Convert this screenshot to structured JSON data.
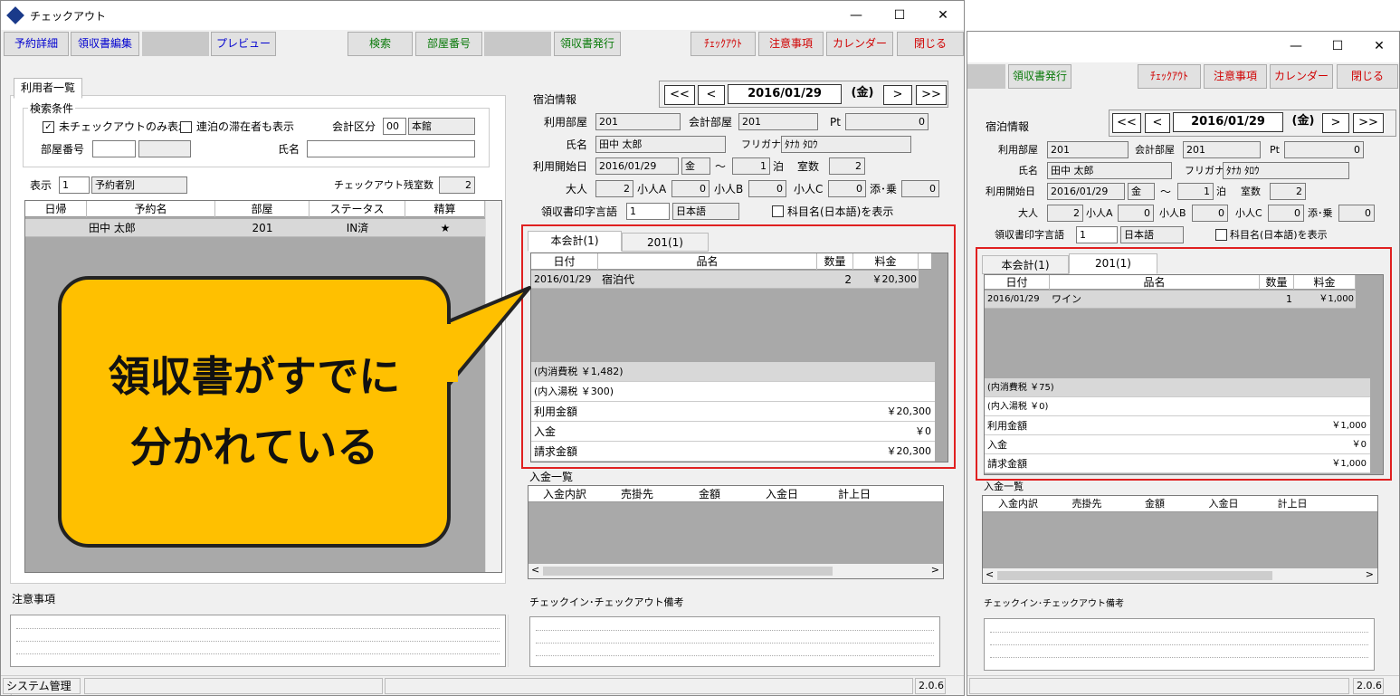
{
  "left": {
    "title": "チェックアウト",
    "toolbar": {
      "reservation_detail": "予約詳細",
      "receipt_edit": "領収書編集",
      "preview": "プレビュー",
      "search": "検索",
      "room_number": "部屋番号",
      "receipt_issue": "領収書発行",
      "checkout": "ﾁｪｯｸｱｳﾄ",
      "notes": "注意事項",
      "calendar": "カレンダー",
      "close": "閉じる"
    },
    "users": {
      "tab": "利用者一覧",
      "criteria": "検索条件",
      "only_not_checked_out": "未チェックアウトのみ表示",
      "show_consecutive": "連泊の滞在者も表示",
      "account_division_label": "会計区分",
      "account_division_code": "00",
      "account_division_name": "本館",
      "room_label": "部屋番号",
      "name_label": "氏名",
      "display_label": "表示",
      "display_code": "1",
      "display_name": "予約者別",
      "remaining_label": "チェックアウト残室数",
      "remaining_value": "2",
      "columns": [
        "日帰",
        "予約名",
        "部屋",
        "ステータス",
        "精算"
      ],
      "rows": [
        {
          "daytrip": "",
          "name": "田中 太郎",
          "room": "201",
          "status": "IN済",
          "settle": "★"
        }
      ]
    },
    "stay": {
      "section": "宿泊情報",
      "prev2": "<<",
      "prev": "<",
      "date": "2016/01/29",
      "weekday": "(金)",
      "next": ">",
      "next2": ">>",
      "room_label": "利用部屋",
      "room": "201",
      "acct_room_label": "会計部屋",
      "acct_room": "201",
      "pt_label": "Pt",
      "pt": "0",
      "name_label": "氏名",
      "name": "田中 太郎",
      "kana_label": "フリガナ",
      "kana": "ﾀﾅｶ ﾀﾛｳ",
      "start_label": "利用開始日",
      "start": "2016/01/29",
      "start_wd": "金",
      "tilde": "～",
      "nights": "1",
      "nights_unit": "泊",
      "rooms_label": "室数",
      "rooms": "2",
      "adult_label": "大人",
      "adult": "2",
      "childA_label": "小人A",
      "childA": "0",
      "childB_label": "小人B",
      "childB": "0",
      "childC_label": "小人C",
      "childC": "0",
      "infant_label": "添･乗",
      "infant": "0",
      "lang_label": "領収書印字言語",
      "lang_code": "1",
      "lang_name": "日本語",
      "show_item_jp": "科目名(日本語)を表示"
    },
    "bill": {
      "tabs": [
        "本会計(1)",
        "201(1)"
      ],
      "columns": [
        "日付",
        "品名",
        "数量",
        "料金"
      ],
      "items": [
        {
          "date": "2016/01/29",
          "name": "宿泊代",
          "qty": "2",
          "price": "￥20,300"
        }
      ],
      "tax": "(内消費税 ￥1,482)",
      "bath_tax": "(内入湯税 ￥300)",
      "totals": [
        {
          "label": "利用金額",
          "value": "￥20,300"
        },
        {
          "label": "入金",
          "value": "￥0"
        },
        {
          "label": "請求金額",
          "value": "￥20,300"
        }
      ]
    },
    "payments": {
      "title": "入金一覧",
      "columns": [
        "入金内訳",
        "売掛先",
        "金額",
        "入金日",
        "計上日"
      ]
    },
    "notes_label": "注意事項",
    "remarks_label": "チェックイン･チェックアウト備考",
    "status": {
      "user": "システム管理者",
      "version": "2.0.6"
    }
  },
  "right": {
    "toolbar": {
      "receipt_issue": "領収書発行",
      "checkout": "ﾁｪｯｸｱｳﾄ",
      "notes": "注意事項",
      "calendar": "カレンダー",
      "close": "閉じる"
    },
    "stay": {
      "section": "宿泊情報",
      "prev2": "<<",
      "prev": "<",
      "date": "2016/01/29",
      "weekday": "(金)",
      "next": ">",
      "next2": ">>",
      "room_label": "利用部屋",
      "room": "201",
      "acct_room_label": "会計部屋",
      "acct_room": "201",
      "pt_label": "Pt",
      "pt": "0",
      "name_label": "氏名",
      "name": "田中 太郎",
      "kana_label": "フリガナ",
      "kana": "ﾀﾅｶ ﾀﾛｳ",
      "start_label": "利用開始日",
      "start": "2016/01/29",
      "start_wd": "金",
      "tilde": "～",
      "nights": "1",
      "nights_unit": "泊",
      "rooms_label": "室数",
      "rooms": "2",
      "adult_label": "大人",
      "adult": "2",
      "childA_label": "小人A",
      "childA": "0",
      "childB_label": "小人B",
      "childB": "0",
      "childC_label": "小人C",
      "childC": "0",
      "infant_label": "添･乗",
      "infant": "0",
      "lang_label": "領収書印字言語",
      "lang_code": "1",
      "lang_name": "日本語",
      "show_item_jp": "科目名(日本語)を表示"
    },
    "bill": {
      "tabs": [
        "本会計(1)",
        "201(1)"
      ],
      "columns": [
        "日付",
        "品名",
        "数量",
        "料金"
      ],
      "items": [
        {
          "date": "2016/01/29",
          "name": "ワイン",
          "qty": "1",
          "price": "￥1,000"
        }
      ],
      "tax": "(内消費税 ￥75)",
      "bath_tax": "(内入湯税 ￥0)",
      "totals": [
        {
          "label": "利用金額",
          "value": "￥1,000"
        },
        {
          "label": "入金",
          "value": "￥0"
        },
        {
          "label": "請求金額",
          "value": "￥1,000"
        }
      ]
    },
    "payments": {
      "title": "入金一覧",
      "columns": [
        "入金内訳",
        "売掛先",
        "金額",
        "入金日",
        "計上日"
      ]
    },
    "remarks_label": "チェックイン･チェックアウト備考",
    "status": {
      "version": "2.0.6"
    }
  },
  "callout": {
    "line1": "領収書がすでに",
    "line2": "分かれている"
  },
  "colors": {
    "highlight": "#e02020",
    "callout_fill": "#ffc000"
  }
}
